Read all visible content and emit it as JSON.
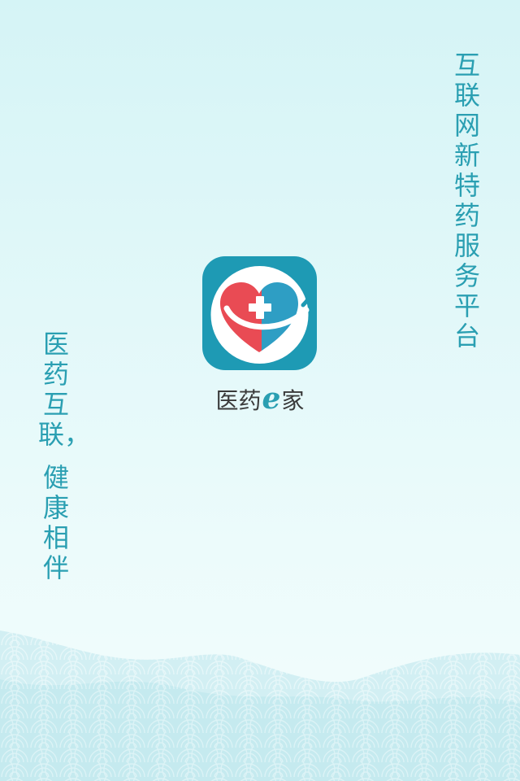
{
  "splash": {
    "tagline_right": "互联网新特药服务平台",
    "tagline_left_1": "医药互联，",
    "tagline_left_2": "健康相伴",
    "brand": {
      "prefix": "医药",
      "e": "e",
      "suffix": "家"
    },
    "logo_icon": "heart-cross-logo-icon"
  },
  "colors": {
    "accent": "#2a9fb2",
    "logo_bg": "#1e9ab4",
    "heart_red": "#e94b54",
    "heart_blue": "#2e9ec4",
    "text_dark": "#3a3a3a"
  }
}
